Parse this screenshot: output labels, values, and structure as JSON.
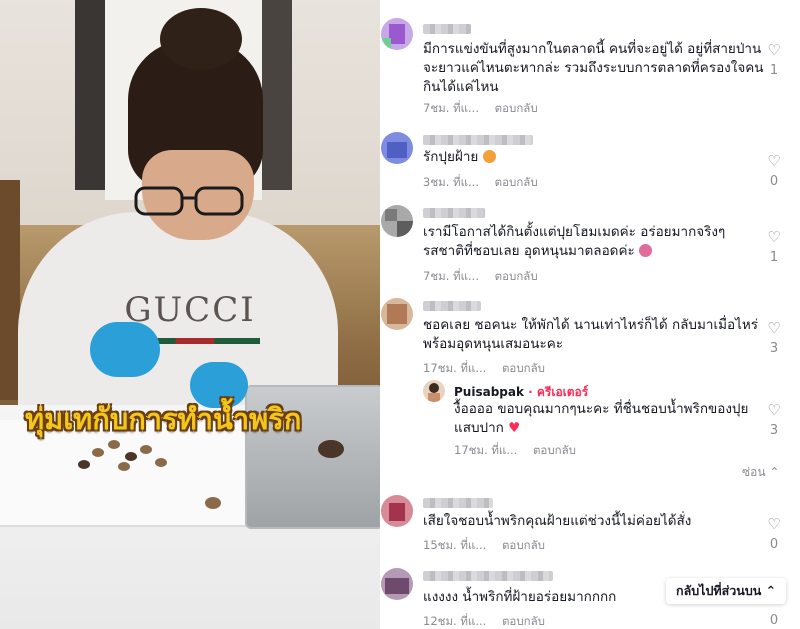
{
  "video": {
    "shirt_text": "GUCCI",
    "caption": "ทุ่มเทกับการทำน้ำพริก"
  },
  "comments": [
    {
      "text": "มีการแข่งขันที่สูงมากในตลาดนี้ คนที่จะอยู่ได้ อยู่ที่สายป่านจะยาวแค่ไหนตะหากล่ะ รวมถึงระบบการตลาดที่ครองใจคนกินได้แค่ไหน",
      "time": "7ชม. ที่แ...",
      "reply_label": "ตอบกลับ",
      "likes": "1",
      "avatar_color": "#b78ad6"
    },
    {
      "text": "รักปุยฝ้าย",
      "time": "3ชม. ที่แ...",
      "reply_label": "ตอบกลับ",
      "likes": "0",
      "avatar_color": "#6b7fd8"
    },
    {
      "text": "เรามีโอกาสได้กินตั้งแต่ปุยโฮมเมดค่ะ อร่อยมากจริงๆ รสชาติที่ชอบเลย อุดหนุนมาตลอดค่ะ",
      "time": "7ชม. ที่แ...",
      "reply_label": "ตอบกลับ",
      "likes": "1",
      "avatar_color": "#9a9a9a"
    },
    {
      "text": "ชอคเลย ชอคนะ ให้พักได้ นานเท่าไหร่ก็ได้ กลับมาเมื่อไหร่พร้อมอุดหนุนเสมอนะคะ",
      "time": "17ชม. ที่แ...",
      "reply_label": "ตอบกลับ",
      "likes": "3",
      "avatar_color": "#c79a7a"
    },
    {
      "text": "เสียใจชอบน้ำพริกคุณฝ้ายแต่ช่วงนี้ไม่ค่อยได้สั่ง",
      "time": "15ชม. ที่แ...",
      "reply_label": "ตอบกลับ",
      "likes": "0",
      "avatar_color": "#c15a6e"
    },
    {
      "text": "แงงงง น้ำพริกที่ฝ้ายอร่อยมากกกก",
      "time": "12ชม. ที่แ...",
      "reply_label": "ตอบกลับ",
      "likes": "0",
      "avatar_color": "#8e6b8e"
    }
  ],
  "creator_reply": {
    "username": "Puisabpak",
    "badge": "· ครีเอเตอร์",
    "text": "งื้ออออ ขอบคุณมากๆนะคะ ที่ชื่นชอบน้ำพริกของปุยแสบปาก",
    "time": "17ชม. ที่แ...",
    "reply_label": "ตอบกลับ",
    "likes": "3"
  },
  "collapse_label": "ซ่อน ⌃",
  "back_button_label": "กลับไปที่ส่วนบน ⌃",
  "colors": {
    "accent": "#fe2c55",
    "muted": "#8a8b91",
    "caption_yellow": "#f3c61a"
  }
}
